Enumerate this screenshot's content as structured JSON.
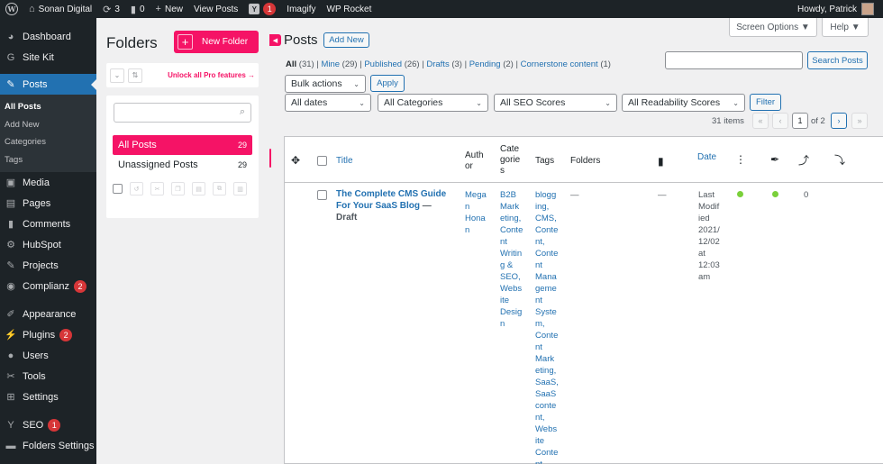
{
  "admin_bar": {
    "site_name": "Sonan Digital",
    "updates_count": "3",
    "comments_count": "0",
    "new_label": "New",
    "view_posts": "View Posts",
    "seo_badge": "1",
    "imagify": "Imagify",
    "wp_rocket": "WP Rocket",
    "howdy": "Howdy, Patrick"
  },
  "sidebar": {
    "items": [
      {
        "label": "Dashboard",
        "icon": "dashboard-icon"
      },
      {
        "label": "Site Kit",
        "icon": "site-kit-icon"
      },
      {
        "label": "Posts",
        "icon": "pin-icon"
      },
      {
        "label": "Media",
        "icon": "media-icon"
      },
      {
        "label": "Pages",
        "icon": "pages-icon"
      },
      {
        "label": "Comments",
        "icon": "comments-icon"
      },
      {
        "label": "HubSpot",
        "icon": "hubspot-icon"
      },
      {
        "label": "Projects",
        "icon": "projects-icon"
      },
      {
        "label": "Complianz",
        "icon": "complianz-icon",
        "badge": "2"
      },
      {
        "label": "Appearance",
        "icon": "appearance-icon"
      },
      {
        "label": "Plugins",
        "icon": "plugins-icon",
        "badge": "2"
      },
      {
        "label": "Users",
        "icon": "users-icon"
      },
      {
        "label": "Tools",
        "icon": "tools-icon"
      },
      {
        "label": "Settings",
        "icon": "settings-icon"
      },
      {
        "label": "SEO",
        "icon": "yoast-icon",
        "badge": "1"
      },
      {
        "label": "Folders Settings",
        "icon": "folders-icon"
      }
    ],
    "posts_submenu": [
      "All Posts",
      "Add New",
      "Categories",
      "Tags"
    ]
  },
  "folders": {
    "title": "Folders",
    "new_folder": "New Folder",
    "unlock": "Unlock all Pro features →",
    "rows": [
      {
        "label": "All Posts",
        "count": "29"
      },
      {
        "label": "Unassigned Posts",
        "count": "29"
      }
    ]
  },
  "posts": {
    "title": "Posts",
    "add_new": "Add New",
    "screen_options": "Screen Options ▼",
    "help": "Help ▼",
    "views": {
      "all": "All",
      "all_count": "(31)",
      "mine": "Mine",
      "mine_count": "(29)",
      "published": "Published",
      "published_count": "(26)",
      "drafts": "Drafts",
      "drafts_count": "(3)",
      "pending": "Pending",
      "pending_count": "(2)",
      "cornerstone": "Cornerstone content",
      "cornerstone_count": "(1)"
    },
    "search_button": "Search Posts",
    "bulk_actions": "Bulk actions",
    "apply": "Apply",
    "filters": {
      "dates": "All dates",
      "categories": "All Categories",
      "seo": "All SEO Scores",
      "readability": "All Readability Scores",
      "filter_button": "Filter"
    },
    "pagination": {
      "items": "31 items",
      "first": "«",
      "prev": "‹",
      "current": "1",
      "of": "of 2",
      "next": "›",
      "last": "»"
    },
    "columns": {
      "title": "Title",
      "author": "Auth\nor",
      "categories": "Cate\ngorie\ns",
      "tags": "Tags",
      "folders": "Folders",
      "date": "Date"
    },
    "row": {
      "title": "The Complete CMS Guide For Your SaaS Blog",
      "state": "— Draft",
      "author": "Mega\nn\nHona\nn",
      "categories": "B2B\nMark\neting,\nConte\nnt\nWritin\ng &\nSEO,\nWebs\nite\nDesig\nn",
      "tags": "blogg\ning,\nCMS,\nConte\nnt,\nConte\nnt\nMana\ngeme\nnt\nSyste\nm,\nConte\nnt\nMark\neting,\nSaaS,\nSaaS\nconte\nnt,\nWebs\nite\nConte\nnt",
      "folders": "—",
      "comments": "—",
      "date": "Last\nModif\nied\n2021/\n12/02\nat\n12:03\nam",
      "links": "0"
    }
  }
}
